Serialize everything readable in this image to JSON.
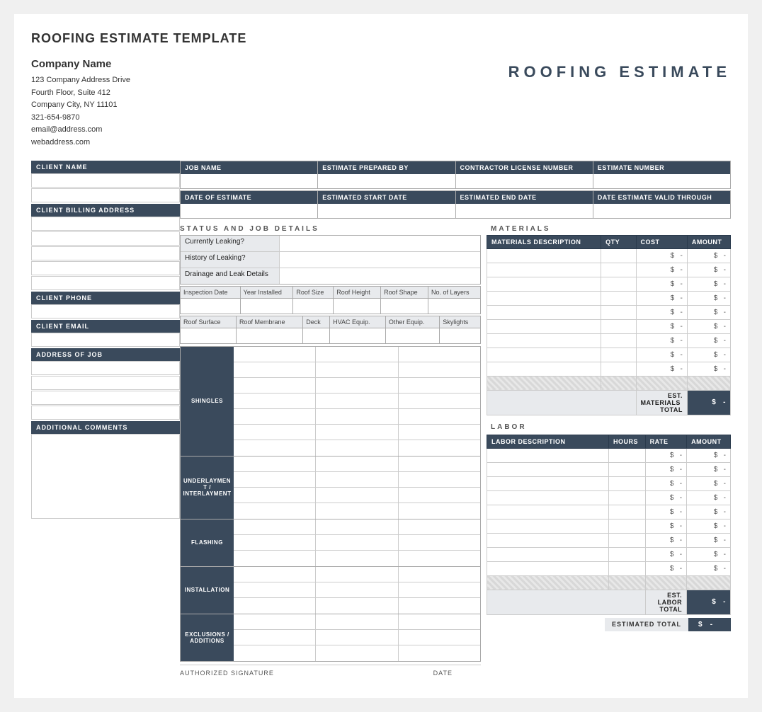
{
  "page": {
    "title": "ROOFING ESTIMATE TEMPLATE",
    "roofing_estimate_heading": "ROOFING  ESTIMATE"
  },
  "company": {
    "name": "Company Name",
    "address1": "123 Company Address Drive",
    "address2": "Fourth Floor, Suite 412",
    "address3": "Company City, NY  11101",
    "phone": "321-654-9870",
    "email": "email@address.com",
    "web": "webaddress.com"
  },
  "sidebar": {
    "client_name_label": "CLIENT NAME",
    "client_billing_label": "CLIENT BILLING ADDRESS",
    "client_phone_label": "CLIENT PHONE",
    "client_email_label": "CLIENT EMAIL",
    "address_of_job_label": "ADDRESS OF JOB",
    "additional_comments_label": "ADDITIONAL COMMENTS"
  },
  "top_grid": {
    "row1": [
      {
        "header": "JOB NAME",
        "value": ""
      },
      {
        "header": "ESTIMATE PREPARED BY",
        "value": ""
      },
      {
        "header": "CONTRACTOR LICENSE NUMBER",
        "value": ""
      },
      {
        "header": "ESTIMATE NUMBER",
        "value": ""
      }
    ],
    "row2": [
      {
        "header": "DATE OF ESTIMATE",
        "value": ""
      },
      {
        "header": "ESTIMATED START DATE",
        "value": ""
      },
      {
        "header": "ESTIMATED END DATE",
        "value": ""
      },
      {
        "header": "DATE ESTIMATE VALID THROUGH",
        "value": ""
      }
    ]
  },
  "status_section": {
    "heading": "STATUS AND JOB DETAILS",
    "fields": [
      {
        "label": "Currently Leaking?",
        "value": ""
      },
      {
        "label": "History of Leaking?",
        "value": ""
      },
      {
        "label": "Drainage and Leak Details",
        "value": ""
      }
    ]
  },
  "roof_detail_row1": {
    "cols": [
      "Inspection Date",
      "Year Installed",
      "Roof Size",
      "Roof Height",
      "Roof Shape",
      "No. of Layers"
    ]
  },
  "roof_detail_row2": {
    "cols": [
      "Roof Surface",
      "Roof Membrane",
      "Deck",
      "HVAC Equip.",
      "Other Equip.",
      "Skylights"
    ]
  },
  "job_sections": [
    {
      "label": "SHINGLES",
      "rows": 7
    },
    {
      "label": "UNDERLAYMENT / INTERLAYMENT",
      "rows": 4
    },
    {
      "label": "FLASHING",
      "rows": 3
    },
    {
      "label": "INSTALLATION",
      "rows": 3
    },
    {
      "label": "EXCLUSIONS / ADDITIONS",
      "rows": 3
    }
  ],
  "materials": {
    "heading": "MATERIALS",
    "headers": [
      "MATERIALS DESCRIPTION",
      "QTY",
      "COST",
      "AMOUNT"
    ],
    "rows": 11,
    "dollar_sign": "$",
    "dash": "-",
    "total_label": "EST. MATERIALS  TOTAL",
    "total_dollar": "$",
    "total_value": "-"
  },
  "labor": {
    "heading": "LABOR",
    "headers": [
      "LABOR DESCRIPTION",
      "HOURS",
      "RATE",
      "AMOUNT"
    ],
    "rows": 11,
    "dollar_sign": "$",
    "dash": "-",
    "total_label": "EST. LABOR TOTAL",
    "total_dollar": "$",
    "total_value": "-"
  },
  "footer": {
    "authorized_signature": "AUTHORIZED SIGNATURE",
    "date_label": "DATE",
    "estimated_total_label": "ESTIMATED TOTAL",
    "estimated_total_dollar": "$",
    "estimated_total_value": "-"
  }
}
